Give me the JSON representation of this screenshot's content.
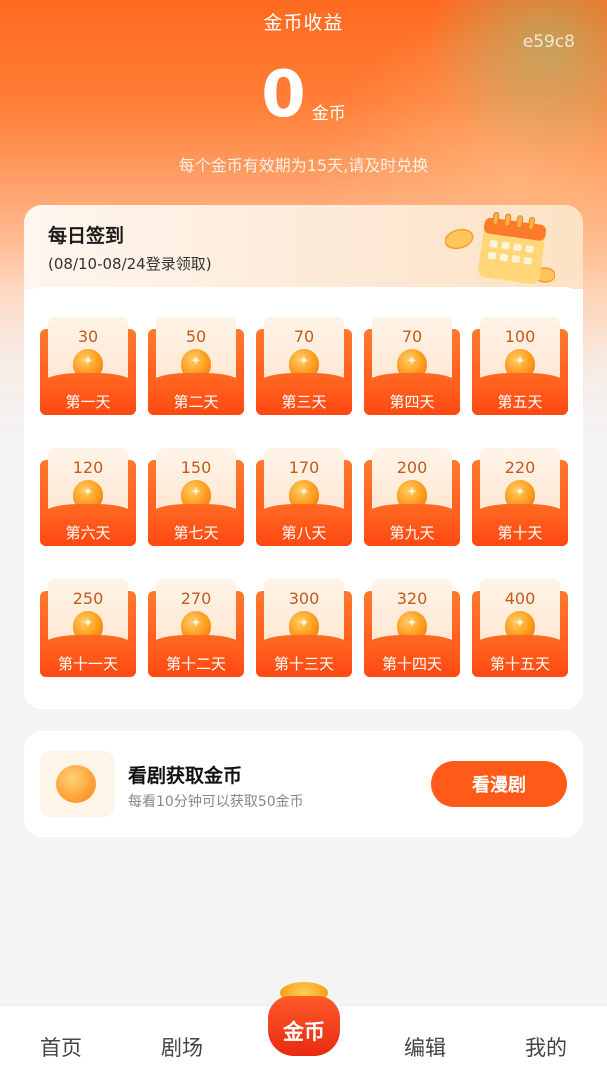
{
  "header": {
    "title": "金币收益",
    "watermark": "e59c8",
    "balance_value": "0",
    "balance_unit": "金币",
    "validity_note": "每个金币有效期为15天,请及时兑换"
  },
  "signin": {
    "title": "每日签到",
    "range": "(08/10-08/24登录领取)",
    "days": [
      {
        "amount": "30",
        "label": "第一天"
      },
      {
        "amount": "50",
        "label": "第二天"
      },
      {
        "amount": "70",
        "label": "第三天"
      },
      {
        "amount": "70",
        "label": "第四天"
      },
      {
        "amount": "100",
        "label": "第五天"
      },
      {
        "amount": "120",
        "label": "第六天"
      },
      {
        "amount": "150",
        "label": "第七天"
      },
      {
        "amount": "170",
        "label": "第八天"
      },
      {
        "amount": "200",
        "label": "第九天"
      },
      {
        "amount": "220",
        "label": "第十天"
      },
      {
        "amount": "250",
        "label": "第十一天"
      },
      {
        "amount": "270",
        "label": "第十二天"
      },
      {
        "amount": "300",
        "label": "第十三天"
      },
      {
        "amount": "320",
        "label": "第十四天"
      },
      {
        "amount": "400",
        "label": "第十五天"
      }
    ]
  },
  "task": {
    "title": "看剧获取金币",
    "description": "每看10分钟可以获取50金币",
    "button_label": "看漫剧"
  },
  "tabbar": {
    "home": "首页",
    "theater": "剧场",
    "coins": "金币",
    "edit": "编辑",
    "mine": "我的"
  },
  "colors": {
    "accent": "#ff5a17",
    "header_gradient_top": "#ff6a1f",
    "coin_gold": "#ff9a1a"
  },
  "icons": {
    "coin": "coin-icon",
    "calendar": "calendar-icon",
    "coin_pouch": "coin-pouch-icon"
  }
}
